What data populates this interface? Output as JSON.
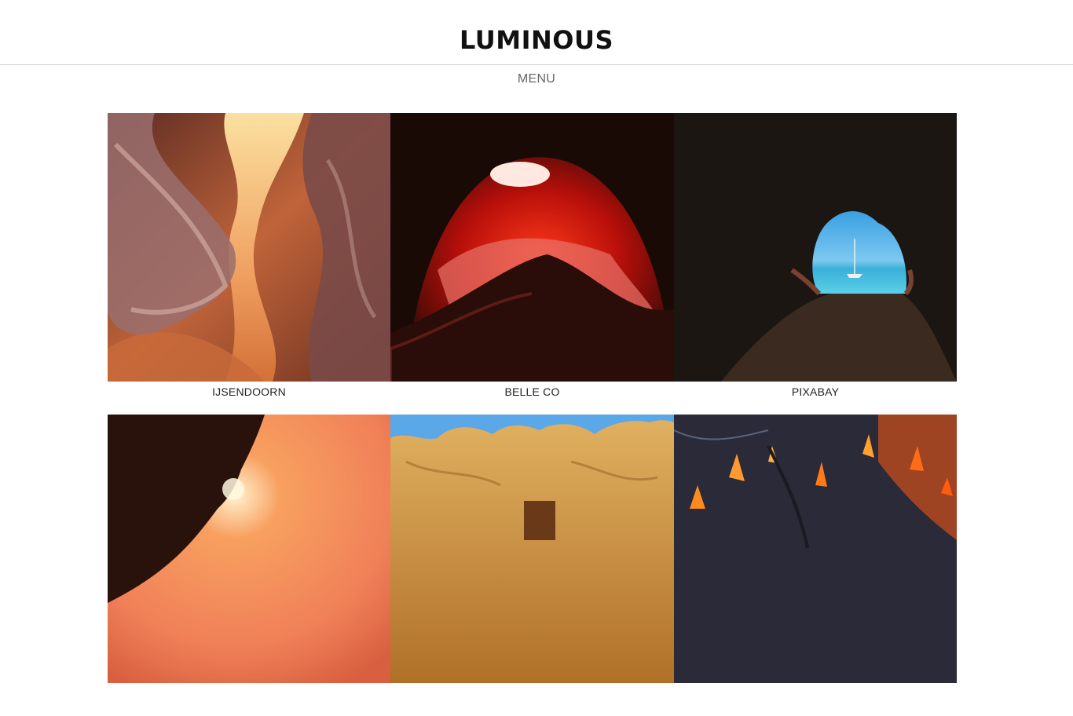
{
  "site": {
    "title": "LUMINOUS"
  },
  "nav": {
    "menu_label": "MENU"
  },
  "gallery": {
    "items": [
      {
        "caption": "IJSENDOORN"
      },
      {
        "caption": "BELLE CO"
      },
      {
        "caption": "PIXABAY"
      },
      {
        "caption": ""
      },
      {
        "caption": ""
      },
      {
        "caption": ""
      }
    ]
  }
}
